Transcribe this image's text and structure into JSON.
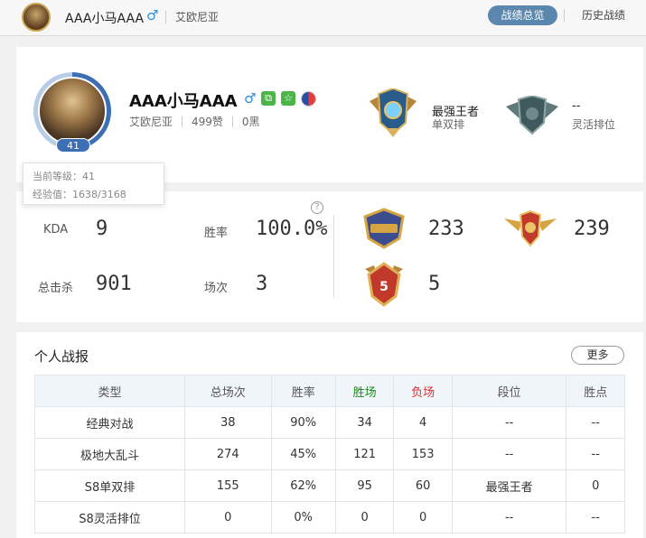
{
  "header": {
    "name": "AAA小马AAA",
    "gender": "♂",
    "server": "艾欧尼亚",
    "tabs": [
      "战绩总览",
      "历史战绩"
    ]
  },
  "profile": {
    "name": "AAA小马AAA",
    "gender": "♂",
    "server": "艾欧尼亚",
    "likes": "499赞",
    "black": "0黑",
    "level": "41",
    "level_progress": 0.52,
    "tooltip": {
      "level_text": "当前等级：41",
      "exp_text": "经验值：1638/3168"
    }
  },
  "ranks": [
    {
      "title": "最强王者",
      "subtitle": "单双排"
    },
    {
      "title": "--",
      "subtitle": "灵活排位"
    }
  ],
  "stats": {
    "kda_label": "KDA",
    "kda": "9",
    "winrate_label": "胜率",
    "winrate": "100.0%",
    "kills_label": "总击杀",
    "kills": "901",
    "games_label": "场次",
    "games": "3",
    "help": "?",
    "badges": [
      {
        "icon": "mvp-badge-icon",
        "value": "233"
      },
      {
        "icon": "winged-medal-icon",
        "value": "239"
      },
      {
        "icon": "pentakill-medal-icon",
        "value": "5",
        "label": "5"
      }
    ]
  },
  "report": {
    "title": "个人战报",
    "more": "更多",
    "columns": [
      "类型",
      "总场次",
      "胜率",
      "胜场",
      "负场",
      "段位",
      "胜点"
    ],
    "rows": [
      [
        "经典对战",
        "38",
        "90%",
        "34",
        "4",
        "--",
        "--"
      ],
      [
        "极地大乱斗",
        "274",
        "45%",
        "121",
        "153",
        "--",
        "--"
      ],
      [
        "S8单双排",
        "155",
        "62%",
        "95",
        "60",
        "最强王者",
        "0"
      ],
      [
        "S8灵活排位",
        "0",
        "0%",
        "0",
        "0",
        "--",
        "--"
      ]
    ]
  },
  "colors": {
    "accent": "#5b87ae",
    "win": "#1a8a1a",
    "loss": "#d93030",
    "gender": "#2e8bd8"
  }
}
